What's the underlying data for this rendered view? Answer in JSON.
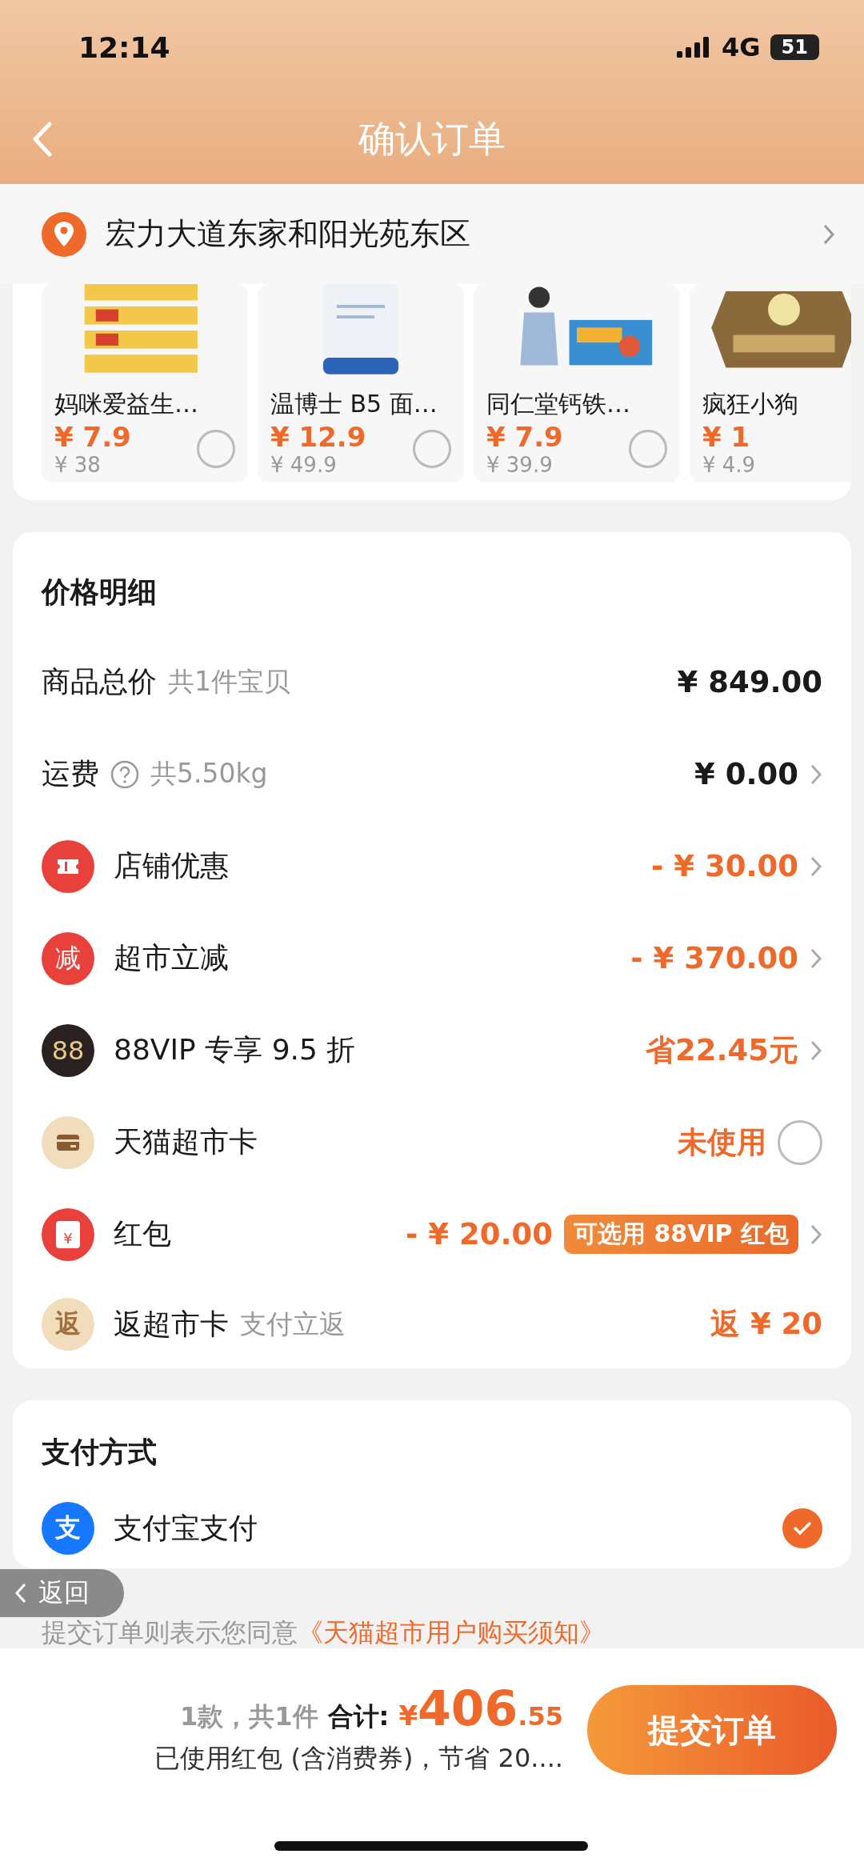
{
  "status_bar": {
    "time": "12:14",
    "network": "4G",
    "battery": "51"
  },
  "header": {
    "title": "确认订单"
  },
  "address": {
    "text": "宏力大道东家和阳光苑东区"
  },
  "products": [
    {
      "name": "妈咪爱益生…",
      "price": "¥ 7.9",
      "original_price": "¥ 38",
      "checked": false,
      "kind": "sticks"
    },
    {
      "name": "温博士 B5 面…",
      "price": "¥ 12.9",
      "original_price": "¥ 49.9",
      "checked": false,
      "kind": "bottle"
    },
    {
      "name": "同仁堂钙铁…",
      "price": "¥ 7.9",
      "original_price": "¥ 39.9",
      "checked": false,
      "kind": "box"
    },
    {
      "name": "疯狂小狗",
      "price": "¥ 1",
      "original_price": "¥ 4.9",
      "kind": "bag"
    }
  ],
  "price_detail": {
    "title": "价格明细",
    "rows": [
      {
        "kind": "plain",
        "label": "商品总价",
        "note": "共1件宝贝",
        "value": "¥ 849.00",
        "accent": false,
        "chevron": false
      },
      {
        "kind": "plain",
        "help": true,
        "label": "运费",
        "note": "共5.50kg",
        "value": "¥ 0.00",
        "accent": false,
        "chevron": true
      },
      {
        "kind": "ticket",
        "label": "店铺优惠",
        "value": "- ¥ 30.00",
        "accent": true,
        "chevron": true
      },
      {
        "kind": "discount",
        "icon_text": "减",
        "label": "超市立减",
        "value": "- ¥ 370.00",
        "accent": true,
        "chevron": true
      },
      {
        "kind": "vip",
        "icon_text": "88",
        "label": "88VIP 专享 9.5 折",
        "value": "省22.45元",
        "accent": true,
        "chevron": true
      },
      {
        "kind": "card",
        "label": "天猫超市卡",
        "value": "未使用",
        "accent": true,
        "chevron": false,
        "checked": false
      },
      {
        "kind": "envelope",
        "icon_text": "¥",
        "label": "红包",
        "value": "- ¥ 20.00",
        "badge": "可选用 88VIP 红包",
        "accent": true,
        "chevron": true
      },
      {
        "kind": "rebate",
        "icon_text": "返",
        "label": "返超市卡",
        "note": "支付立返",
        "value": "返 ¥ 20",
        "accent": true,
        "chevron": false
      }
    ]
  },
  "payment": {
    "title": "支付方式",
    "methods": [
      {
        "label": "支付宝支付",
        "icon_text": "支",
        "selected": true
      }
    ]
  },
  "agreement": {
    "text": "提交订单则表示您同意",
    "link": "《天猫超市用户购买须知》"
  },
  "back_pill": {
    "label": "返回"
  },
  "footer": {
    "count": "1款，共1件",
    "total_label": "合计:",
    "currency": "¥",
    "total_int": "406",
    "total_dec": ".55",
    "savings": "已使用红包 (含消费券)，节省 20....",
    "submit": "提交订单"
  }
}
